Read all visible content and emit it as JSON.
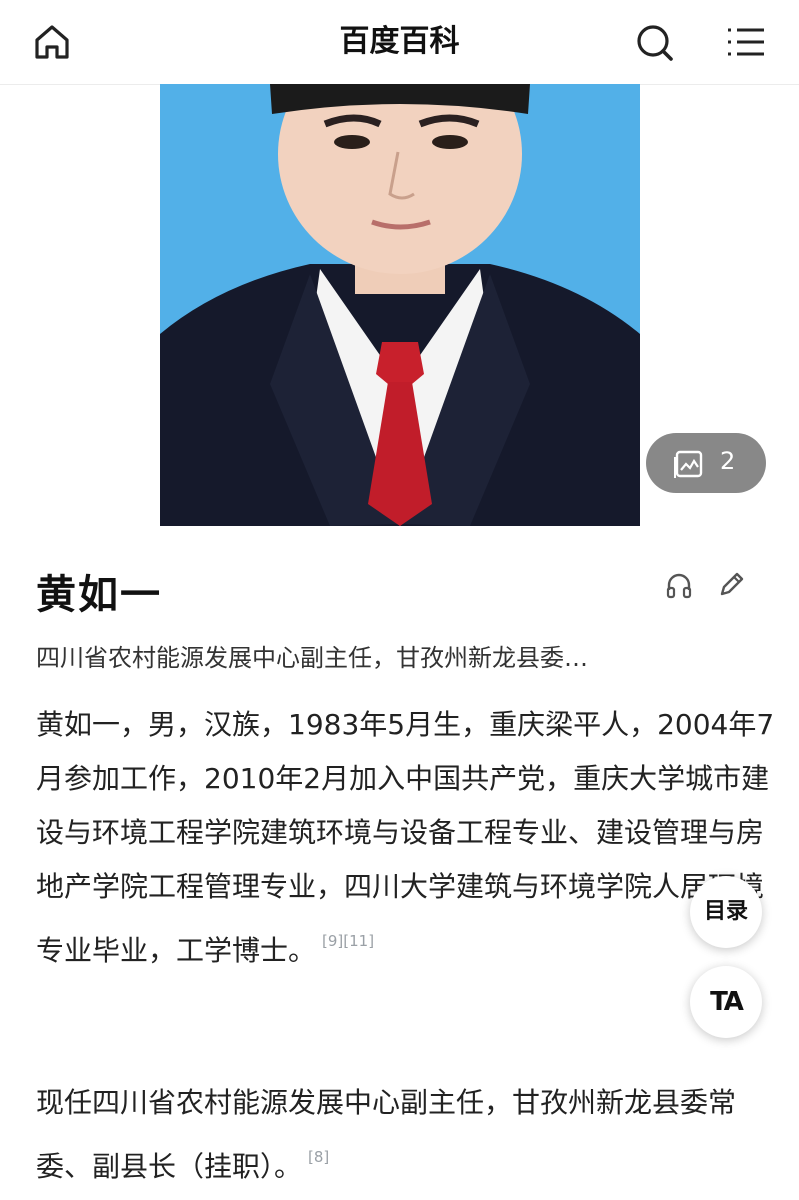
{
  "header": {
    "title": "百度百科"
  },
  "hero": {
    "gallery_count": "2"
  },
  "entry": {
    "name": "黄如一",
    "subtitle": "四川省农村能源发展中心副主任，甘孜州新龙县委…",
    "paragraphs": [
      {
        "text": "黄如一，男，汉族，1983年5月生，重庆梁平人，2004年7月参加工作，2010年2月加入中国共产党，重庆大学城市建设与环境工程学院建筑环境与设备工程专业、建设管理与房地产学院工程管理专业，四川大学建筑与环境学院人居环境专业毕业，工学博士。",
        "ref": "[9][11]"
      },
      {
        "text": "现任四川省农村能源发展中心副主任，甘孜州新龙县委常委、副县长（挂职）。",
        "ref": "[8]"
      }
    ]
  },
  "floating": {
    "toc_label": "目录",
    "ta_label": "TA"
  }
}
